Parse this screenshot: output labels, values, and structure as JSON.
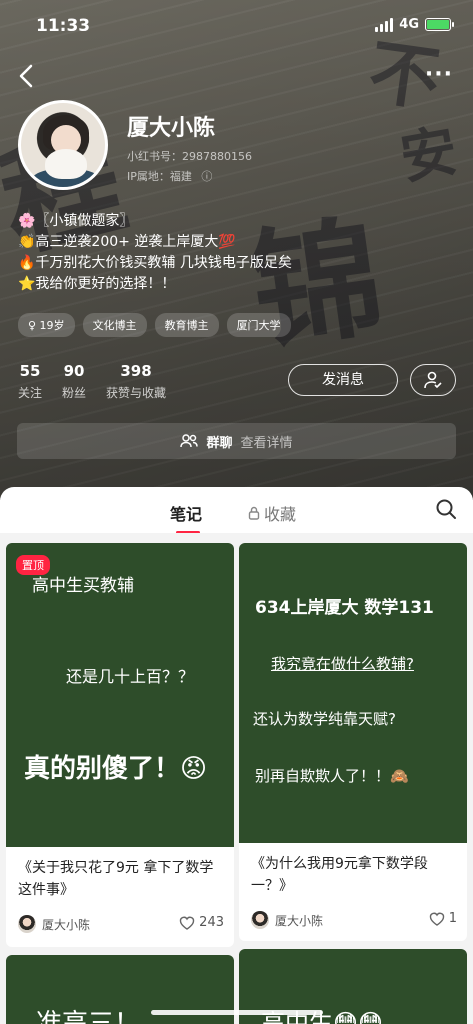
{
  "status_bar": {
    "time": "11:33",
    "network": "4G"
  },
  "profile": {
    "name": "厦大小陈",
    "id_text": "小红书号：2987880156",
    "ip_text": "IP属地：福建",
    "bio_lines": [
      "🌸〖小镇做题家〗",
      "👏高三逆袭200+ 逆袭上岸厦大💯",
      "🔥千万别花大价钱买教辅 几块钱电子版足矣",
      "⭐我给你更好的选择！！"
    ],
    "tags": [
      "♀ 19岁",
      "文化博主",
      "教育博主",
      "厦门大学"
    ],
    "stats": [
      {
        "num": "55",
        "label": "关注"
      },
      {
        "num": "90",
        "label": "粉丝"
      },
      {
        "num": "398",
        "label": "获赞与收藏"
      }
    ],
    "message_button": "发消息",
    "group_label": "群聊",
    "group_sub": "查看详情"
  },
  "tabs": {
    "notes": "笔记",
    "favorites": "收藏"
  },
  "notes": [
    {
      "pinned": "置顶",
      "cover_lines": [
        "高中生买教辅",
        "还是几十上百？？",
        "真的别傻了！😡"
      ],
      "title": "《关于我只花了9元 拿下了数学这件事》",
      "author": "厦大小陈",
      "likes": "243"
    },
    {
      "cover_lines": [
        "634上岸厦大 数学131",
        "我究竟在做什么教辅?",
        "还认为数学纯靠天赋?",
        "别再自欺欺人了！！🙈"
      ],
      "title": "《为什么我用9元拿下数学段一？》",
      "author": "厦大小陈",
      "likes": "1"
    },
    {
      "cover_lines": [
        "准高三！"
      ]
    },
    {
      "cover_lines": [
        "高中生😳😳"
      ]
    }
  ],
  "colors": {
    "accent": "#ff2442",
    "cover_green": "#2e4d2a"
  }
}
